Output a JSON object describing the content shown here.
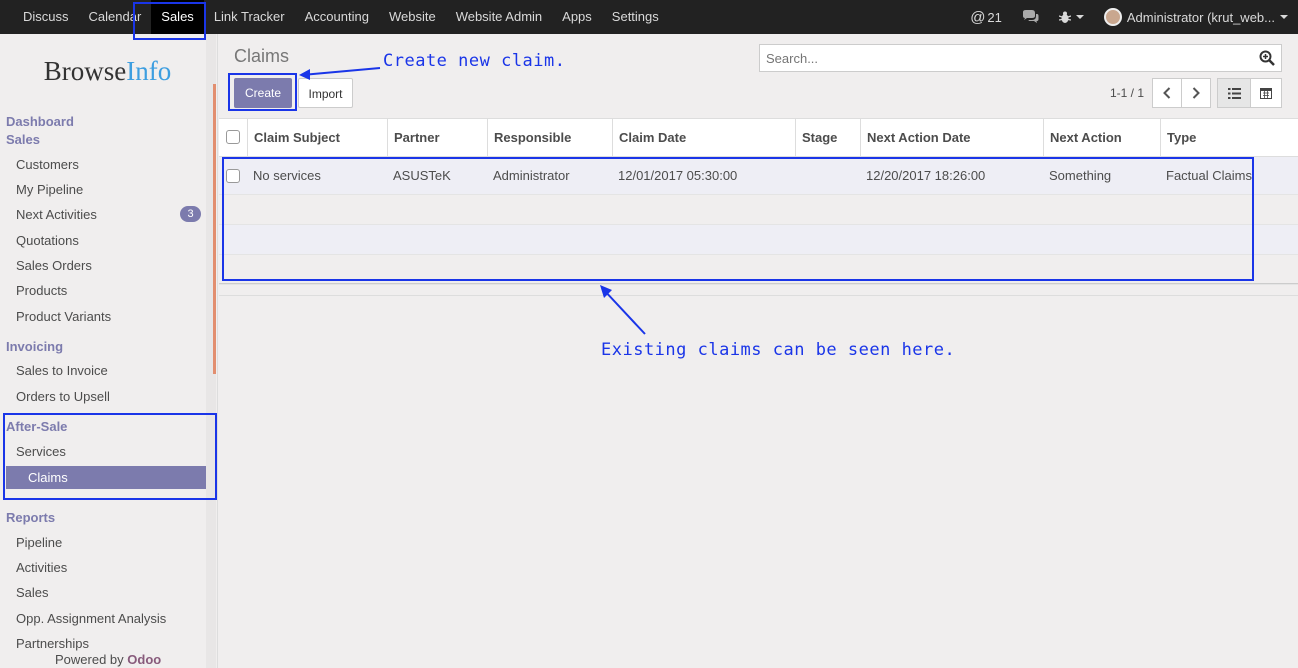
{
  "topnav": {
    "items": [
      "Discuss",
      "Calendar",
      "Sales",
      "Link Tracker",
      "Accounting",
      "Website",
      "Website Admin",
      "Apps",
      "Settings"
    ],
    "active": "Sales",
    "mentions_count": "21",
    "user": "Administrator (krut_web..."
  },
  "sidebar": {
    "logo_part1": "Browse",
    "logo_part2": "Info",
    "sections": [
      {
        "title": "Dashboard"
      },
      {
        "title": "Sales",
        "items": [
          "Customers",
          "My Pipeline",
          "Next Activities",
          "Quotations",
          "Sales Orders",
          "Products",
          "Product Variants"
        ]
      },
      {
        "title": "Invoicing",
        "items": [
          "Sales to Invoice",
          "Orders to Upsell"
        ]
      },
      {
        "title": "After-Sale",
        "items": [
          "Services",
          "Claims"
        ]
      },
      {
        "title": "Reports",
        "items": [
          "Pipeline",
          "Activities",
          "Sales",
          "Opp. Assignment Analysis",
          "Partnerships"
        ]
      }
    ],
    "next_activities_badge": "3",
    "active_item": "Claims",
    "powered_by": "Powered by",
    "powered_brand": "Odoo"
  },
  "main": {
    "title": "Claims",
    "create_label": "Create",
    "import_label": "Import",
    "search_placeholder": "Search...",
    "pager": "1-1 / 1"
  },
  "table": {
    "columns": [
      "Claim Subject",
      "Partner",
      "Responsible",
      "Claim Date",
      "Stage",
      "Next Action Date",
      "Next Action",
      "Type"
    ],
    "rows": [
      {
        "subject": "No services",
        "partner": "ASUSTeK",
        "responsible": "Administrator",
        "claim_date": "12/01/2017 05:30:00",
        "stage": "",
        "next_action_date": "12/20/2017 18:26:00",
        "next_action": "Something",
        "type": "Factual Claims"
      }
    ]
  },
  "annotations": {
    "create_note": "Create new claim.",
    "existing_note": "Existing claims can be seen here."
  },
  "colors": {
    "accent": "#7c7bad",
    "annotation": "#1a35e8",
    "topbar": "#222222"
  }
}
